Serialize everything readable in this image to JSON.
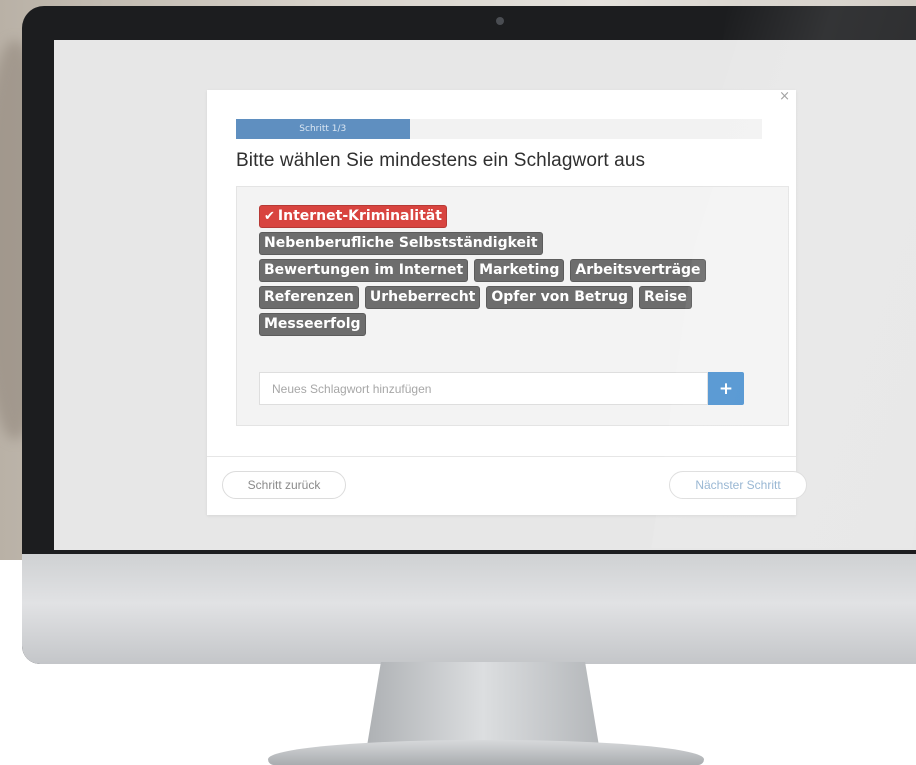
{
  "modal": {
    "close_glyph": "×",
    "progress": {
      "label": "Schritt 1/3",
      "fraction": 0.33
    },
    "title": "Bitte wählen Sie mindestens ein Schlagwort aus",
    "tag_rows": [
      [
        {
          "label": "Internet-Kriminalität",
          "selected": true
        }
      ],
      [
        {
          "label": "Nebenberufliche Selbstständigkeit",
          "selected": false
        }
      ],
      [
        {
          "label": "Bewertungen im Internet",
          "selected": false
        },
        {
          "label": "Marketing",
          "selected": false
        },
        {
          "label": "Arbeitsverträge",
          "selected": false
        }
      ],
      [
        {
          "label": "Referenzen",
          "selected": false
        },
        {
          "label": "Urheberrecht",
          "selected": false
        },
        {
          "label": "Opfer von Betrug",
          "selected": false
        },
        {
          "label": "Reise",
          "selected": false
        }
      ],
      [
        {
          "label": "Messeerfolg",
          "selected": false
        }
      ]
    ],
    "selected_icon": "checkmark-icon",
    "new_tag": {
      "placeholder": "Neues Schlagwort hinzufügen",
      "value": "",
      "add_label": "+"
    },
    "footer": {
      "back_label": "Schritt zurück",
      "next_label": "Nächster Schritt"
    }
  },
  "colors": {
    "tag": "#6d6d6d",
    "tag_selected": "#d8443f",
    "progress": "#5f8fc0",
    "add_button": "#4a90cf",
    "bezel": "#1c1d1f"
  }
}
